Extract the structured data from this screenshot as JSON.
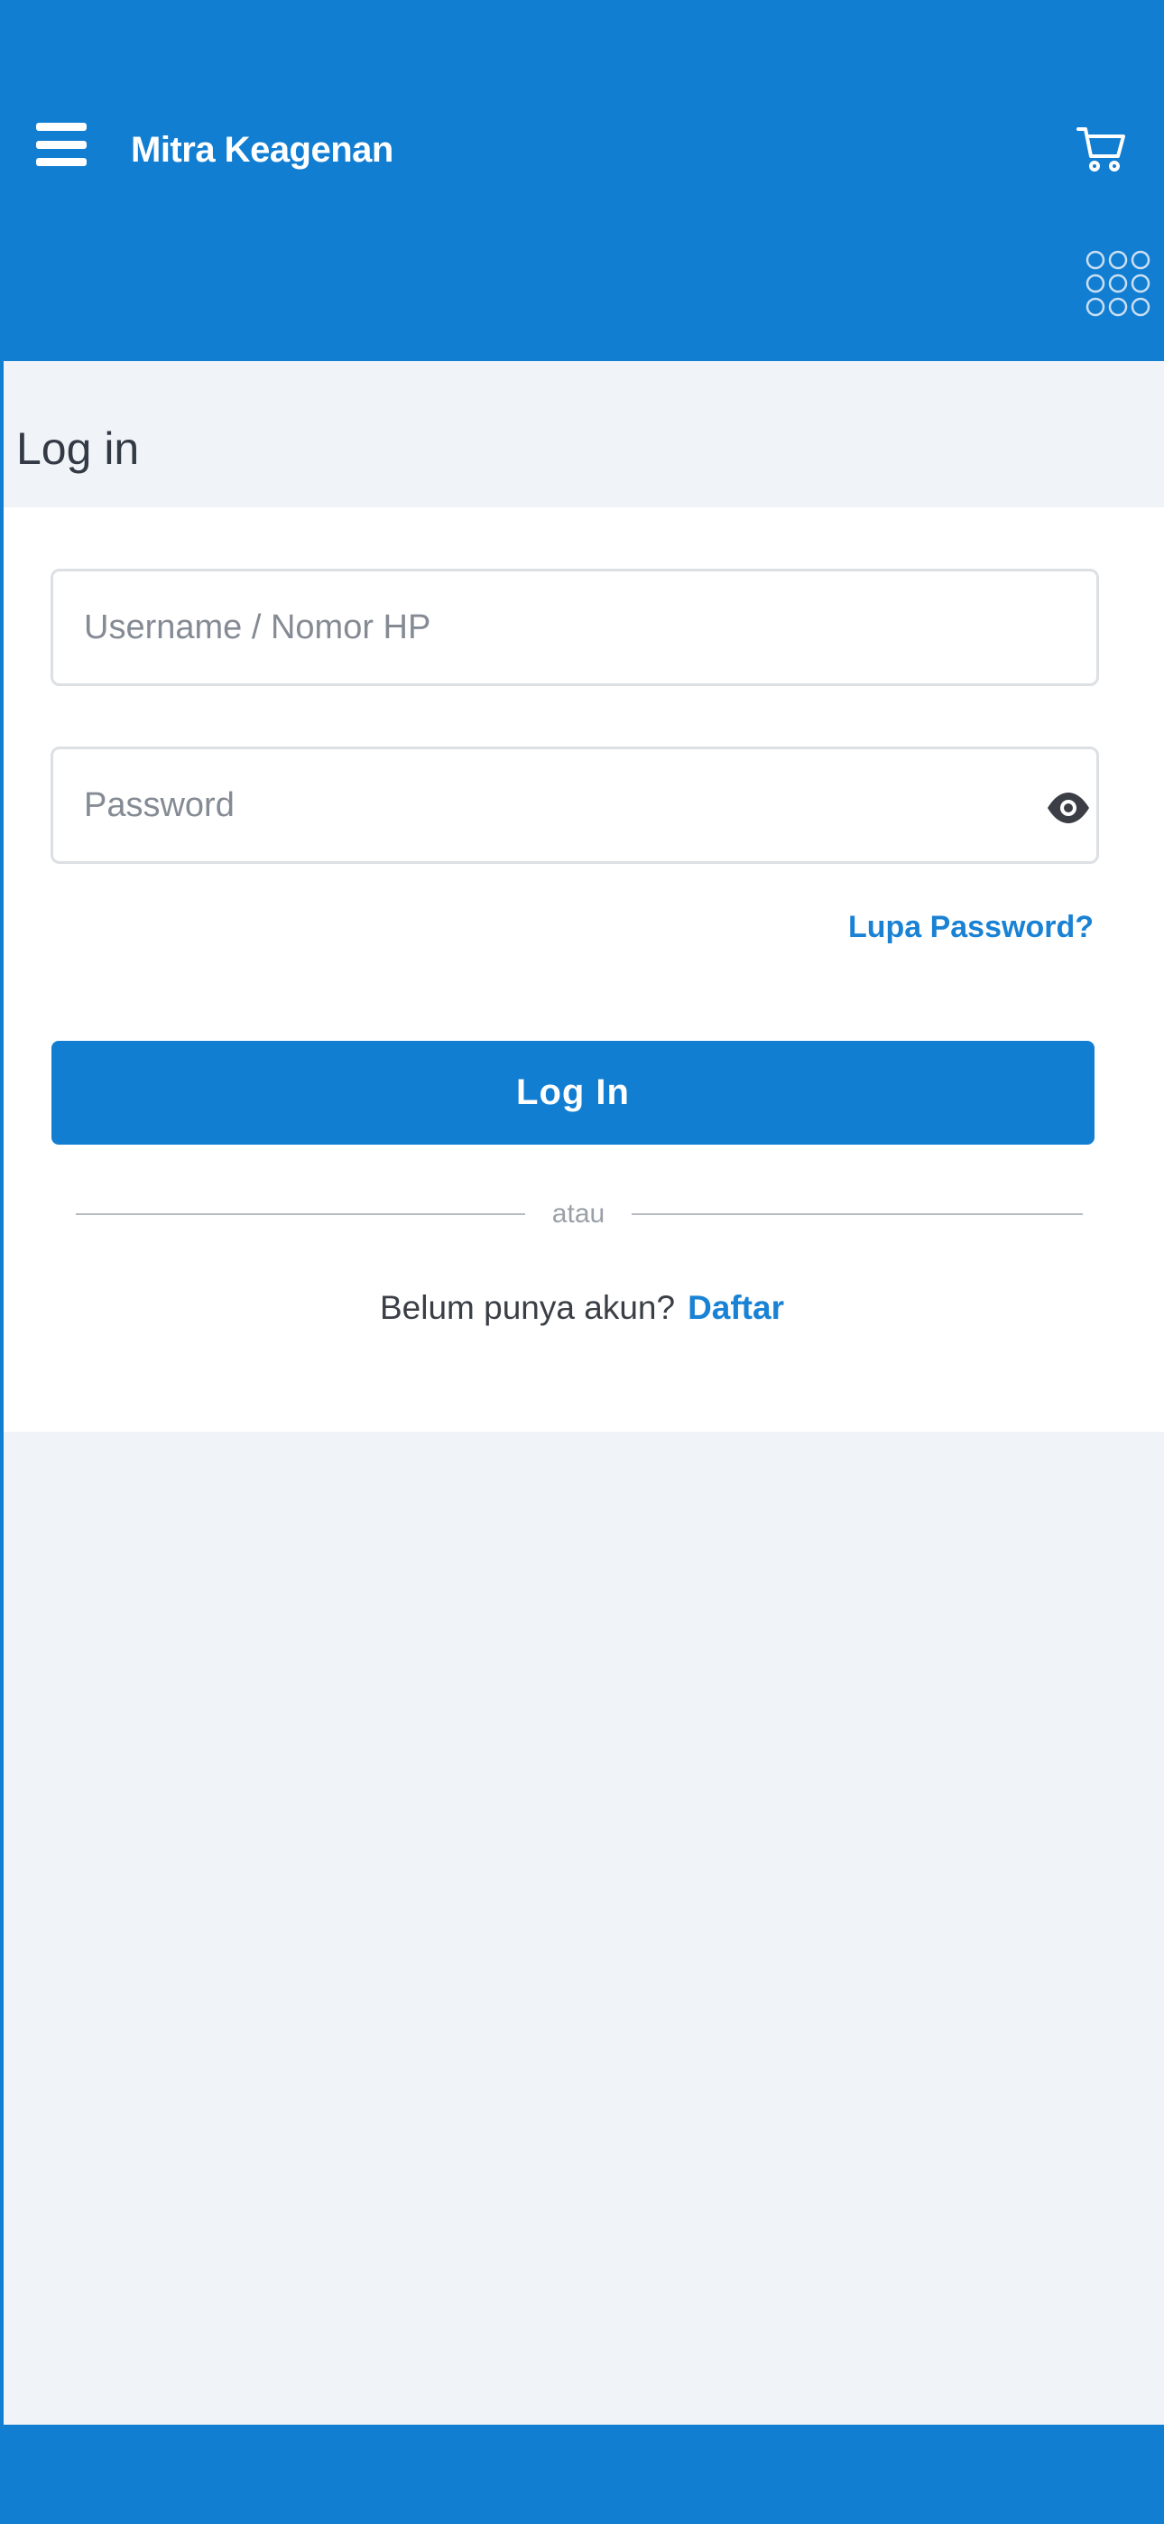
{
  "app": {
    "title": "Mitra Keagenan",
    "colors": {
      "primary": "#127ed2",
      "background": "#f0f4f8",
      "link": "#1a82d4"
    }
  },
  "header": {
    "menu_icon": "hamburger-menu-icon",
    "cart_icon": "shopping-cart-icon",
    "grid_icon": "dots-grid-icon"
  },
  "page": {
    "title": "Log in"
  },
  "form": {
    "username_placeholder": "Username / Nomor HP",
    "username_value": "",
    "password_placeholder": "Password",
    "password_value": "",
    "password_toggle_icon": "eye-icon",
    "forgot_label": "Lupa Password?",
    "login_label": "Log In",
    "divider_text": "atau",
    "signup_prompt": "Belum punya akun?",
    "signup_link": "Daftar"
  }
}
